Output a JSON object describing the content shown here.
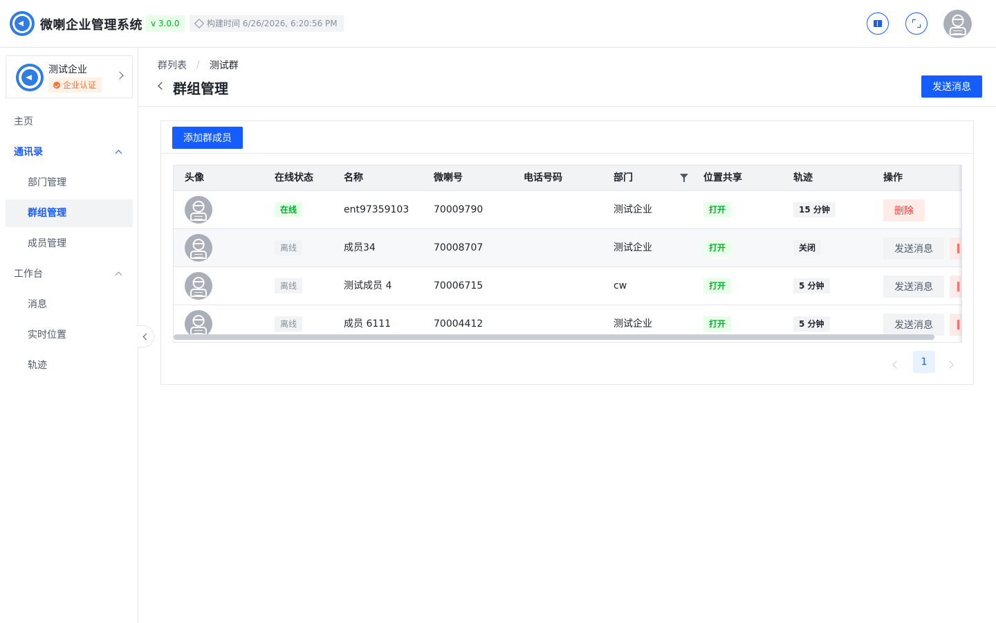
{
  "header": {
    "app_title": "微喇企业管理系统",
    "version": "v 3.0.0",
    "build_time": "构建时间 6/26/2026, 6:20:56 PM",
    "icons": [
      "book-icon",
      "fullscreen-icon",
      "user-avatar"
    ]
  },
  "sidebar": {
    "org": {
      "name": "测试企业",
      "badge": "企业认证"
    },
    "items": [
      {
        "label": "主页"
      },
      {
        "label": "通讯录"
      },
      {
        "label": "部门管理"
      },
      {
        "label": "群组管理"
      },
      {
        "label": "成员管理"
      },
      {
        "label": "工作台"
      },
      {
        "label": "消息"
      },
      {
        "label": "实时位置"
      },
      {
        "label": "轨迹"
      }
    ]
  },
  "page": {
    "breadcrumb": [
      "群列表",
      "测试群"
    ],
    "breadcrumb_sep": "/",
    "title": "群组管理",
    "send_button": "发送消息",
    "add_button": "添加群成员"
  },
  "table": {
    "columns": [
      "头像",
      "在线状态",
      "名称",
      "微喇号",
      "电话号码",
      "部门",
      "位置共享",
      "轨迹",
      "操作"
    ],
    "rows": [
      {
        "status": "在线",
        "name": "ent97359103",
        "id": "70009790",
        "phone": "",
        "dept": "测试企业",
        "share": "打开",
        "track": "15 分钟",
        "action": "删除"
      },
      {
        "status": "离线",
        "name": "成员34",
        "id": "70008707",
        "phone": "",
        "dept": "测试企业",
        "share": "打开",
        "track": "关闭",
        "action": "发送消息"
      },
      {
        "status": "离线",
        "name": "测试成员 4",
        "id": "70006715",
        "phone": "",
        "dept": "cw",
        "share": "打开",
        "track": "5 分钟",
        "action": "发送消息"
      },
      {
        "status": "离线",
        "name": "成员 6111",
        "id": "70004412",
        "phone": "",
        "dept": "测试企业",
        "share": "打开",
        "track": "5 分钟",
        "action": "发送消息"
      }
    ]
  },
  "pagination": {
    "current": "1"
  },
  "colors": {
    "primary": "#165dff",
    "success": "#00b42a",
    "danger": "#f53f3f",
    "warning": "#f77234"
  }
}
